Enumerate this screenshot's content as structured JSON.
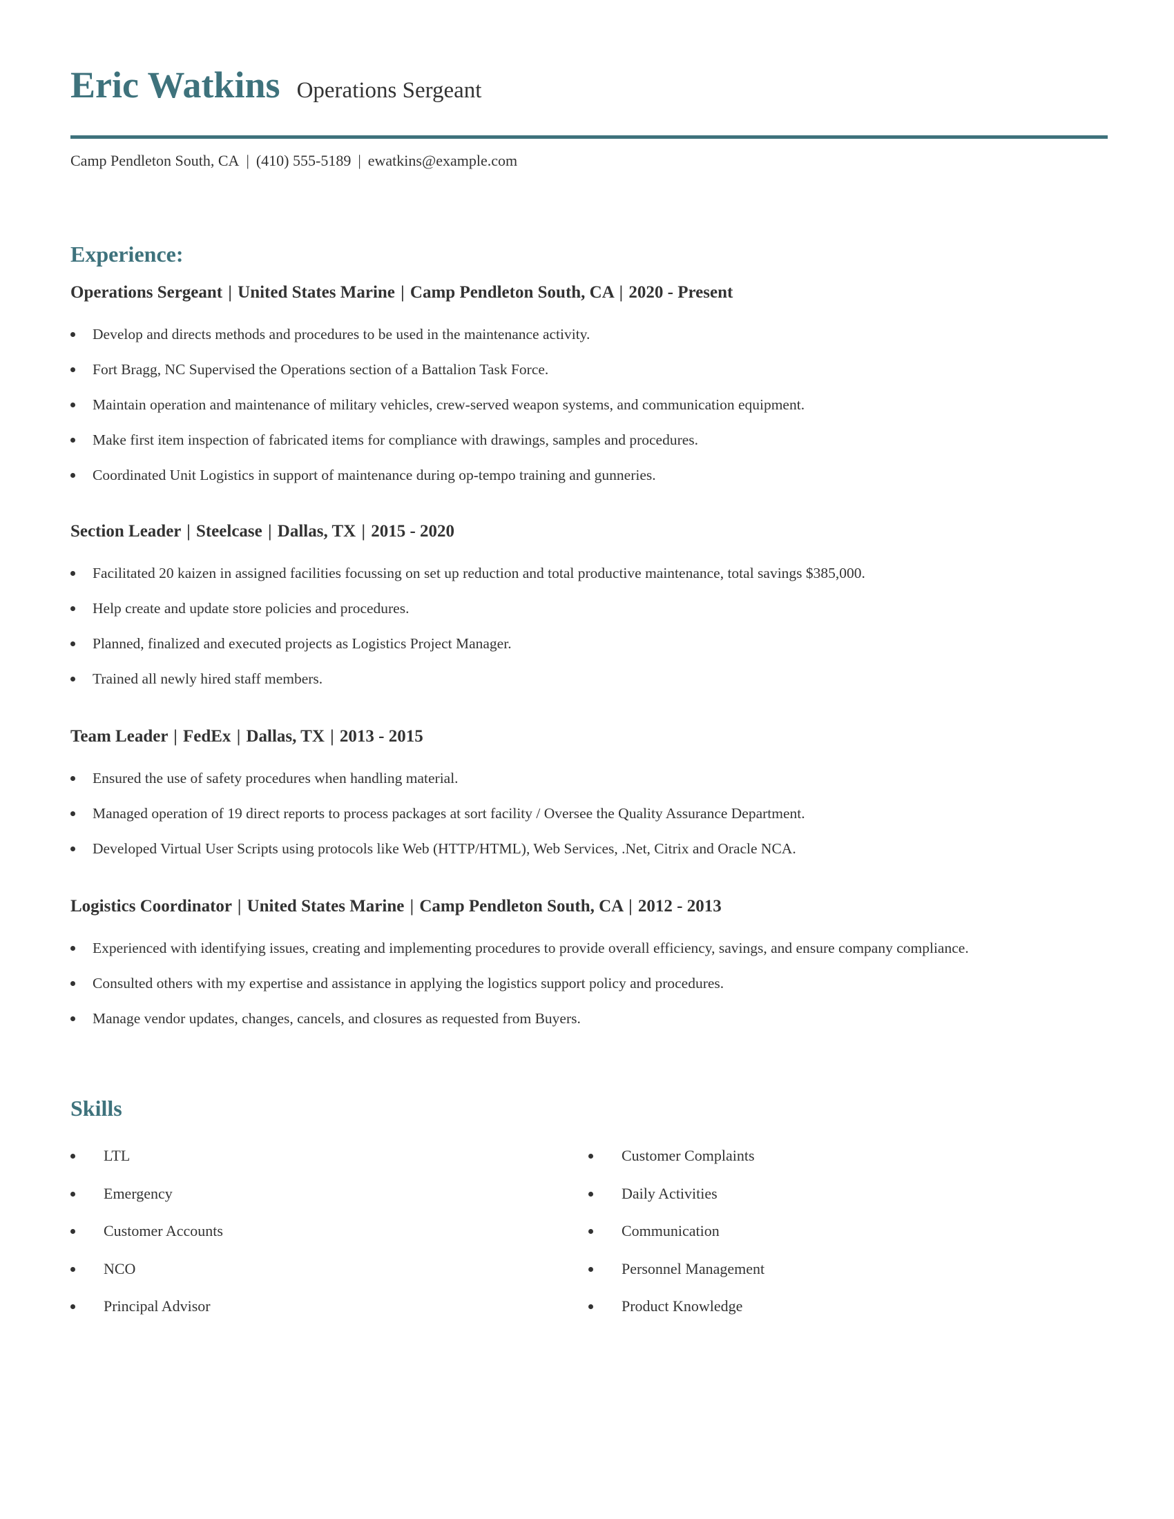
{
  "header": {
    "name": "Eric Watkins",
    "title": "Operations Sergeant",
    "contact": {
      "location": "Camp Pendleton South, CA",
      "phone": "(410) 555-5189",
      "email": "ewatkins@example.com",
      "separator": "|"
    }
  },
  "colors": {
    "accent": "#3e727c",
    "text": "#333333"
  },
  "experience": {
    "heading": "Experience:",
    "jobs": [
      {
        "role": "Operations Sergeant",
        "company": "United States Marine",
        "location": "Camp Pendleton South, CA",
        "dates": "2020 - Present",
        "bullets": [
          "Develop and directs methods and procedures to be used in the maintenance activity.",
          "Fort Bragg, NC Supervised the Operations section of a Battalion Task Force.",
          "Maintain operation and maintenance of military vehicles, crew-served weapon systems, and communication equipment.",
          "Make first item inspection of fabricated items for compliance with drawings, samples and procedures.",
          "Coordinated Unit Logistics in support of maintenance during op-tempo training and gunneries."
        ]
      },
      {
        "role": "Section Leader",
        "company": "Steelcase",
        "location": "Dallas, TX",
        "dates": "2015 - 2020",
        "bullets": [
          "Facilitated 20 kaizen in assigned facilities focussing on set up reduction and total productive maintenance, total savings $385,000.",
          "Help create and update store policies and procedures.",
          "Planned, finalized and executed projects as Logistics Project Manager.",
          "Trained all newly hired staff members."
        ]
      },
      {
        "role": "Team Leader",
        "company": "FedEx",
        "location": "Dallas, TX",
        "dates": "2013 - 2015",
        "bullets": [
          "Ensured the use of safety procedures when handling material.",
          "Managed operation of 19 direct reports to process packages at sort facility / Oversee the Quality Assurance Department.",
          "Developed Virtual User Scripts using protocols like Web (HTTP/HTML), Web Services, .Net, Citrix and Oracle NCA."
        ]
      },
      {
        "role": "Logistics Coordinator",
        "company": "United States Marine",
        "location": "Camp Pendleton South, CA",
        "dates": "2012 - 2013",
        "bullets": [
          "Experienced with identifying issues, creating and implementing procedures to provide overall efficiency, savings, and ensure company compliance.",
          "Consulted others with my expertise and assistance in applying the logistics support policy and procedures.",
          "Manage vendor updates, changes, cancels, and closures as requested from Buyers."
        ]
      }
    ]
  },
  "skills": {
    "heading": "Skills",
    "column_1": [
      "LTL",
      "Emergency",
      "Customer Accounts",
      "NCO",
      "Principal Advisor"
    ],
    "column_2": [
      "Customer Complaints",
      "Daily Activities",
      "Communication",
      "Personnel Management",
      "Product Knowledge"
    ]
  }
}
